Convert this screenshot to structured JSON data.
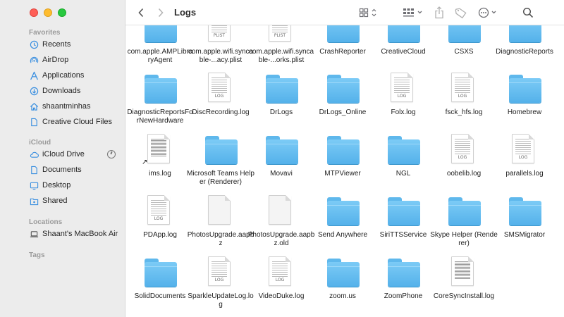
{
  "window": {
    "title": "Logs"
  },
  "sidebar": {
    "favorites_title": "Favorites",
    "favorites": [
      {
        "label": "Recents",
        "icon": "clock-icon"
      },
      {
        "label": "AirDrop",
        "icon": "airdrop-icon"
      },
      {
        "label": "Applications",
        "icon": "applications-icon"
      },
      {
        "label": "Downloads",
        "icon": "download-icon"
      },
      {
        "label": "shaantminhas",
        "icon": "home-icon"
      },
      {
        "label": "Creative Cloud Files",
        "icon": "document-icon"
      }
    ],
    "icloud_title": "iCloud",
    "icloud": [
      {
        "label": "iCloud Drive",
        "icon": "cloud-icon"
      },
      {
        "label": "Documents",
        "icon": "document-icon"
      },
      {
        "label": "Desktop",
        "icon": "desktop-icon"
      },
      {
        "label": "Shared",
        "icon": "shared-folder-icon"
      }
    ],
    "locations_title": "Locations",
    "locations": [
      {
        "label": "Shaant's MacBook Air",
        "icon": "laptop-icon"
      }
    ],
    "tags_title": "Tags"
  },
  "files": {
    "row0": [
      {
        "name": "com.apple.AMPLibraryAgent",
        "kind": "folder"
      },
      {
        "name": "com.apple.wifi.syncable-...acy.plist",
        "kind": "doc",
        "tag": "PLIST"
      },
      {
        "name": "com.apple.wifi.syncable-...orks.plist",
        "kind": "doc",
        "tag": "PLIST"
      },
      {
        "name": "CrashReporter",
        "kind": "folder"
      },
      {
        "name": "CreativeCloud",
        "kind": "folder"
      },
      {
        "name": "CSXS",
        "kind": "folder"
      },
      {
        "name": "DiagnosticReports",
        "kind": "folder"
      }
    ],
    "row1": [
      {
        "name": "DiagnosticReportsForNewHardware",
        "kind": "folder"
      },
      {
        "name": "DiscRecording.log",
        "kind": "doc",
        "tag": "LOG"
      },
      {
        "name": "DrLogs",
        "kind": "folder"
      },
      {
        "name": "DrLogs_Online",
        "kind": "folder"
      },
      {
        "name": "Folx.log",
        "kind": "doc",
        "tag": "LOG"
      },
      {
        "name": "fsck_hfs.log",
        "kind": "doc",
        "tag": "LOG"
      },
      {
        "name": "Homebrew",
        "kind": "folder"
      }
    ],
    "row2": [
      {
        "name": "ims.log",
        "kind": "doc",
        "tag": ""
      },
      {
        "name": "Microsoft Teams Helper (Renderer)",
        "kind": "folder"
      },
      {
        "name": "Movavi",
        "kind": "folder"
      },
      {
        "name": "MTPViewer",
        "kind": "folder"
      },
      {
        "name": "NGL",
        "kind": "folder"
      },
      {
        "name": "oobelib.log",
        "kind": "doc",
        "tag": "LOG"
      },
      {
        "name": "parallels.log",
        "kind": "doc",
        "tag": "LOG"
      }
    ],
    "row3": [
      {
        "name": "PDApp.log",
        "kind": "doc",
        "tag": "LOG"
      },
      {
        "name": "PhotosUpgrade.aapbz",
        "kind": "blank"
      },
      {
        "name": "PhotosUpgrade.aapbz.old",
        "kind": "blank"
      },
      {
        "name": "Send Anywhere",
        "kind": "folder"
      },
      {
        "name": "SiriTTSService",
        "kind": "folder"
      },
      {
        "name": "Skype Helper (Renderer)",
        "kind": "folder"
      },
      {
        "name": "SMSMigrator",
        "kind": "folder"
      }
    ],
    "row4": [
      {
        "name": "SolidDocuments",
        "kind": "folder"
      },
      {
        "name": "SparkleUpdateLog.log",
        "kind": "doc",
        "tag": "LOG"
      },
      {
        "name": "VideoDuke.log",
        "kind": "doc",
        "tag": "LOG"
      },
      {
        "name": "zoom.us",
        "kind": "folder"
      },
      {
        "name": "ZoomPhone",
        "kind": "folder"
      },
      {
        "name": "CoreSyncInstall.log",
        "kind": "doc",
        "tag": ""
      }
    ]
  }
}
